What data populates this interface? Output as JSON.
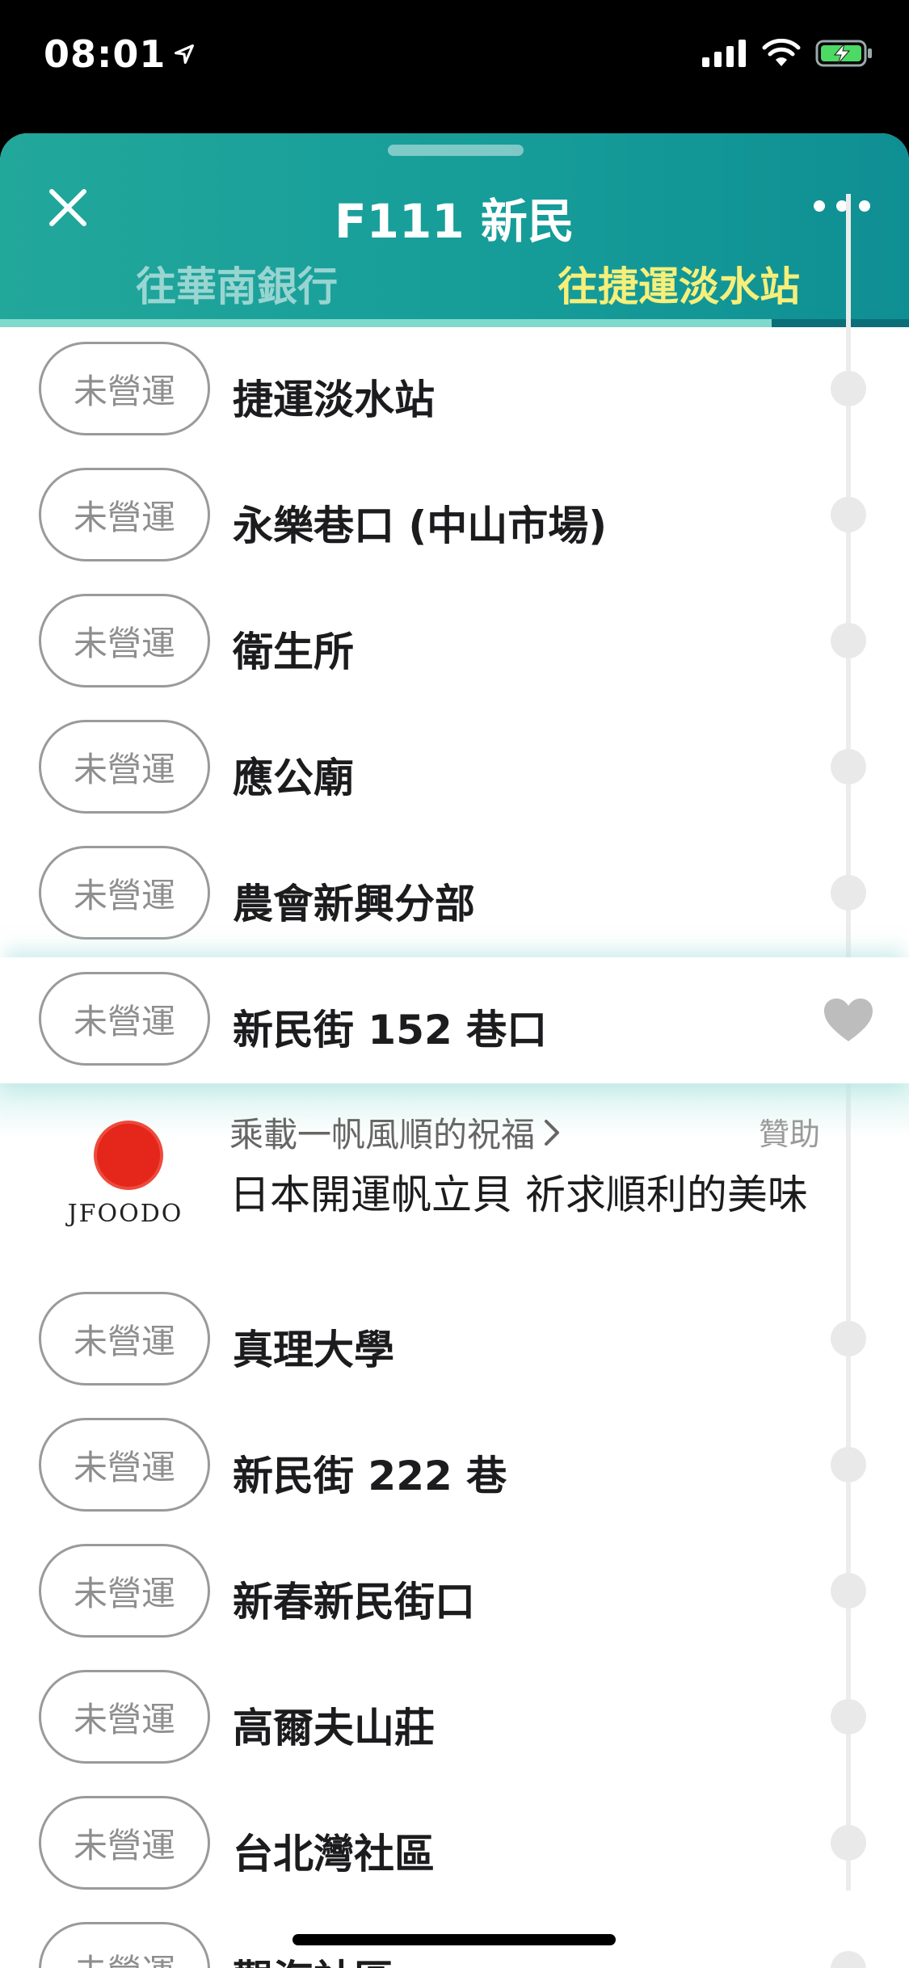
{
  "status": {
    "time": "08:01"
  },
  "header": {
    "title": "F111 新民",
    "tabs": [
      {
        "label": "往華南銀行",
        "active": false
      },
      {
        "label": "往捷運淡水站",
        "active": true
      }
    ]
  },
  "stops_before": [
    {
      "eta": "未營運",
      "name": "捷運淡水站"
    },
    {
      "eta": "未營運",
      "name": "永樂巷口 (中山市場)"
    },
    {
      "eta": "未營運",
      "name": "衛生所"
    },
    {
      "eta": "未營運",
      "name": "應公廟"
    },
    {
      "eta": "未營運",
      "name": "農會新興分部"
    }
  ],
  "current_stop": {
    "eta": "未營運",
    "name": "新民街 152 巷口"
  },
  "ad": {
    "brand": "JFOODO",
    "tagline": "乘載一帆風順的祝福",
    "sponsor_label": "贊助",
    "title": "日本開運帆立貝 祈求順利的美味"
  },
  "stops_after": [
    {
      "eta": "未營運",
      "name": "真理大學"
    },
    {
      "eta": "未營運",
      "name": "新民街 222 巷"
    },
    {
      "eta": "未營運",
      "name": "新春新民街口"
    },
    {
      "eta": "未營運",
      "name": "高爾夫山莊"
    },
    {
      "eta": "未營運",
      "name": "台北灣社區"
    },
    {
      "eta": "未營運",
      "name": "觀海社區"
    }
  ],
  "colors": {
    "header_bg": "#169d99",
    "active_tab": "#f6ef7a",
    "pill_border": "#9a9a9a"
  }
}
